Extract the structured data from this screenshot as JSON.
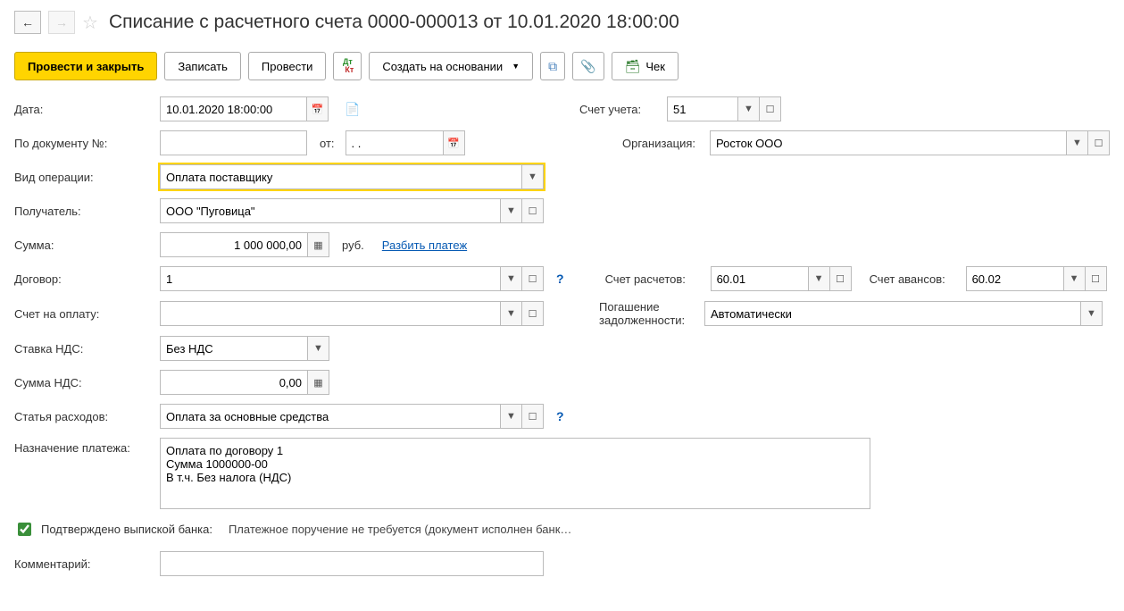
{
  "header": {
    "title": "Списание с расчетного счета 0000-000013 от 10.01.2020 18:00:00"
  },
  "toolbar": {
    "post_and_close": "Провести и закрыть",
    "save": "Записать",
    "post": "Провести",
    "create_based_on": "Создать на основании",
    "receipt": "Чек"
  },
  "labels": {
    "date": "Дата:",
    "doc_number": "По документу №:",
    "from": "от:",
    "operation_type": "Вид операции:",
    "recipient": "Получатель:",
    "sum": "Сумма:",
    "currency": "руб.",
    "split_payment": "Разбить платеж",
    "contract": "Договор:",
    "invoice": "Счет на оплату:",
    "vat_rate": "Ставка НДС:",
    "vat_sum": "Сумма НДС:",
    "expense_item": "Статья расходов:",
    "purpose": "Назначение платежа:",
    "confirmed": "Подтверждено выпиской банка:",
    "payment_order_note": "Платежное поручение не требуется (документ исполнен банк…",
    "comment": "Комментарий:",
    "account": "Счет учета:",
    "organization": "Организация:",
    "settlements_account": "Счет расчетов:",
    "advances_account": "Счет авансов:",
    "debt_repayment": "Погашение задолженности:"
  },
  "fields": {
    "date": "10.01.2020 18:00:00",
    "doc_number": "",
    "doc_from": ". .",
    "operation_type": "Оплата поставщику",
    "recipient": "ООО \"Пуговица\"",
    "sum": "1 000 000,00",
    "contract": "1",
    "invoice": "",
    "vat_rate": "Без НДС",
    "vat_sum": "0,00",
    "expense_item": "Оплата за основные средства",
    "purpose": "Оплата по договору 1\nСумма 1000000-00\nВ т.ч. Без налога (НДС)",
    "confirmed": true,
    "comment": "",
    "account": "51",
    "organization": "Росток ООО",
    "settlements_account": "60.01",
    "advances_account": "60.02",
    "debt_repayment": "Автоматически"
  }
}
